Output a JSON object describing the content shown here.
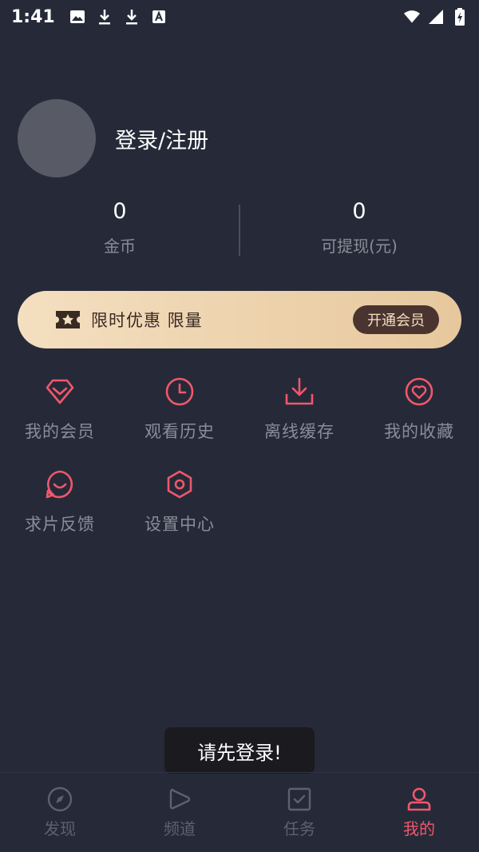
{
  "status_bar": {
    "time": "1:41",
    "left_icons": [
      "image-icon",
      "download-icon",
      "download-icon",
      "a-badge-icon"
    ],
    "right_icons": [
      "wifi-icon",
      "signal-icon",
      "battery-charging-icon"
    ]
  },
  "profile": {
    "login_label": "登录/注册"
  },
  "stats": [
    {
      "value": "0",
      "label": "金币"
    },
    {
      "value": "0",
      "label": "可提现(元)"
    }
  ],
  "vip_banner": {
    "text": "限时优惠 限量",
    "button_label": "开通会员",
    "icon": "ticket-star-icon"
  },
  "menu": [
    {
      "label": "我的会员",
      "icon": "diamond-icon"
    },
    {
      "label": "观看历史",
      "icon": "clock-icon"
    },
    {
      "label": "离线缓存",
      "icon": "download-tray-icon"
    },
    {
      "label": "我的收藏",
      "icon": "heart-circle-icon"
    },
    {
      "label": "求片反馈",
      "icon": "chat-smile-icon"
    },
    {
      "label": "设置中心",
      "icon": "hexagon-settings-icon"
    }
  ],
  "toast": {
    "text": "请先登录!"
  },
  "bottom_nav": [
    {
      "label": "发现",
      "icon": "compass-icon",
      "active": false
    },
    {
      "label": "频道",
      "icon": "play-icon",
      "active": false
    },
    {
      "label": "任务",
      "icon": "task-check-icon",
      "active": false
    },
    {
      "label": "我的",
      "icon": "user-icon",
      "active": true
    }
  ],
  "colors": {
    "background": "#262a38",
    "accent": "#f0576c",
    "muted_text": "#8a8d98",
    "vip_gold": "#e7c89d"
  }
}
